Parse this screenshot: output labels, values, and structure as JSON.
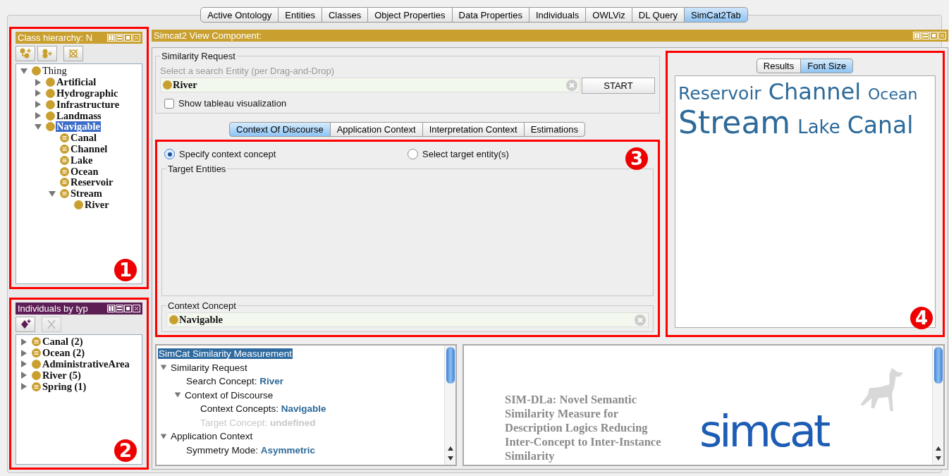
{
  "top_tabs": [
    {
      "label": "Active Ontology",
      "selected": false
    },
    {
      "label": "Entities",
      "selected": false
    },
    {
      "label": "Classes",
      "selected": false
    },
    {
      "label": "Object Properties",
      "selected": false
    },
    {
      "label": "Data Properties",
      "selected": false
    },
    {
      "label": "Individuals",
      "selected": false
    },
    {
      "label": "OWLViz",
      "selected": false
    },
    {
      "label": "DL Query",
      "selected": false
    },
    {
      "label": "SimCat2Tab",
      "selected": true
    }
  ],
  "class_hierarchy": {
    "title": "Class hierarchy: N",
    "callout": "1",
    "tree": [
      {
        "label": "Thing",
        "kind": "primitive",
        "bold": false,
        "selected": false,
        "expanded": true,
        "children": [
          {
            "label": "Artificial",
            "kind": "primitive",
            "bold": true,
            "selected": false,
            "expanded": false
          },
          {
            "label": "Hydrographic",
            "kind": "primitive",
            "bold": true,
            "selected": false,
            "expanded": false
          },
          {
            "label": "Infrastructure",
            "kind": "primitive",
            "bold": true,
            "selected": false,
            "expanded": false
          },
          {
            "label": "Landmass",
            "kind": "primitive",
            "bold": true,
            "selected": false,
            "expanded": false
          },
          {
            "label": "Navigable",
            "kind": "primitive",
            "bold": true,
            "selected": true,
            "expanded": true,
            "children": [
              {
                "label": "Canal",
                "kind": "defined",
                "bold": true,
                "selected": false
              },
              {
                "label": "Channel",
                "kind": "defined",
                "bold": true,
                "selected": false
              },
              {
                "label": "Lake",
                "kind": "defined",
                "bold": true,
                "selected": false
              },
              {
                "label": "Ocean",
                "kind": "defined",
                "bold": true,
                "selected": false
              },
              {
                "label": "Reservoir",
                "kind": "defined",
                "bold": true,
                "selected": false
              },
              {
                "label": "Stream",
                "kind": "defined",
                "bold": true,
                "selected": false,
                "expanded": true,
                "children": [
                  {
                    "label": "River",
                    "kind": "primitive",
                    "bold": true,
                    "selected": false
                  }
                ]
              }
            ]
          }
        ]
      }
    ]
  },
  "individuals": {
    "title": "Individuals by typ",
    "callout": "2",
    "tree": [
      {
        "label": "Canal (2)",
        "kind": "defined",
        "selected": false,
        "expanded": false
      },
      {
        "label": "Ocean (2)",
        "kind": "defined",
        "selected": false,
        "expanded": false
      },
      {
        "label": "AdministrativeArea",
        "kind": "primitive",
        "selected": false,
        "expanded": false
      },
      {
        "label": "River (5)",
        "kind": "primitive",
        "selected": false,
        "expanded": false
      },
      {
        "label": "Spring (1)",
        "kind": "defined",
        "selected": false,
        "expanded": false
      }
    ]
  },
  "simcat": {
    "title": "Simcat2 View Component:",
    "similarity_request": {
      "legend": "Similarity Request",
      "hint": "Select a search Entity (per Drag-and-Drop)",
      "entity": "River",
      "button": "START",
      "checkbox": {
        "label": "Show tableau visualization",
        "checked": false
      }
    },
    "context_tabs": [
      {
        "label": "Context Of Discourse",
        "selected": true
      },
      {
        "label": "Application Context",
        "selected": false
      },
      {
        "label": "Interpretation Context",
        "selected": false
      },
      {
        "label": "Estimations",
        "selected": false
      }
    ],
    "context": {
      "callout": "3",
      "radios": [
        {
          "label": "Specify context concept",
          "selected": true
        },
        {
          "label": "Select target entity(s)",
          "selected": false
        }
      ],
      "target_entities": "Target Entities",
      "context_concept": {
        "legend": "Context Concept",
        "value": "Navigable"
      }
    },
    "results": {
      "callout": "4",
      "tabs": [
        {
          "label": "Results",
          "selected": false
        },
        {
          "label": "Font Size",
          "selected": true
        }
      ],
      "words": [
        "Reservoir",
        "Channel",
        "Ocean",
        "Stream",
        "Lake",
        "Canal"
      ]
    },
    "measurement": {
      "label": "SimCat Similarity Measurement",
      "selected": true,
      "children": [
        {
          "label": "Similarity Request",
          "expanded": true,
          "children": [
            {
              "label": "Search Concept: ",
              "value": "River",
              "disabled": false
            },
            {
              "label": "Context of Discourse",
              "expanded": true,
              "children": [
                {
                  "label": "Context Concepts: ",
                  "value": "Navigable",
                  "disabled": false
                },
                {
                  "label": "Target Concept: ",
                  "value": "undefined",
                  "disabled": true
                }
              ]
            }
          ]
        },
        {
          "label": "Application Context",
          "expanded": true,
          "children": [
            {
              "label": "Symmetry Mode: ",
              "value": "Asymmetric",
              "disabled": false
            }
          ]
        }
      ]
    },
    "paper": {
      "title": "SIM-DLa: Novel Semantic Similarity Measure for Description Logics Reducing Inter-Concept to Inter-Instance Similarity",
      "logo": "simcat"
    }
  }
}
